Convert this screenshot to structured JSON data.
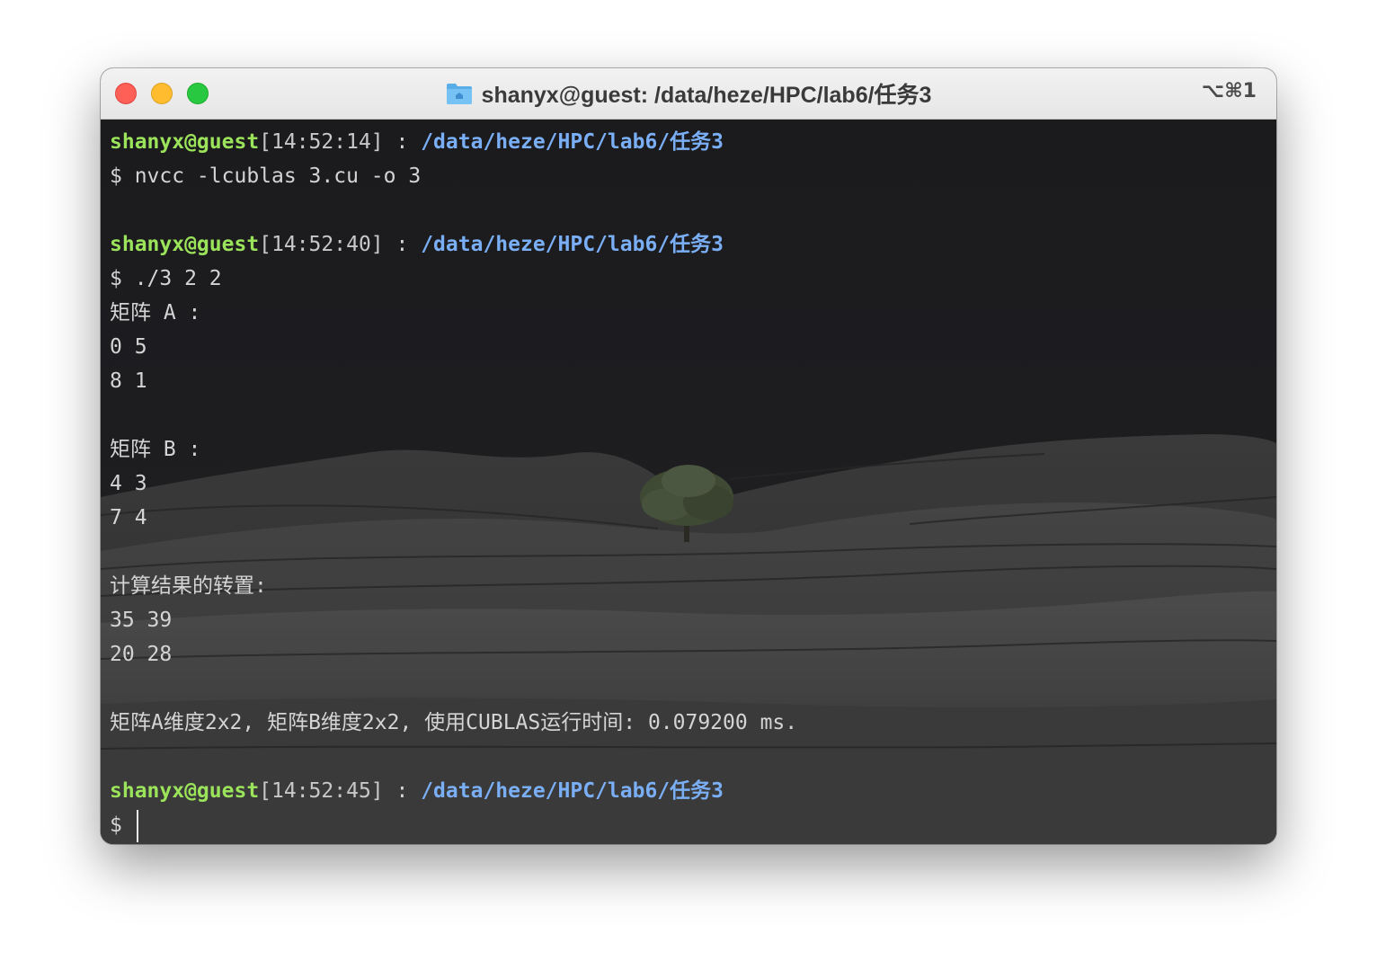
{
  "window": {
    "title": "shanyx@guest: /data/heze/HPC/lab6/任务3",
    "shortcut": "⌥⌘1",
    "icons": {
      "title_icon": "folder-icon"
    },
    "colors": {
      "close": "#fe5f57",
      "minimize": "#febc2e",
      "maximize": "#28c840",
      "prompt_user": "#9be35a",
      "prompt_path": "#7aaef5",
      "text": "#d4d4d4"
    }
  },
  "terminal": {
    "prompts": [
      {
        "user": "shanyx@guest",
        "time": "[14:52:14]",
        "sep": " : ",
        "path": "/data/heze/HPC/lab6/任务3"
      },
      {
        "user": "shanyx@guest",
        "time": "[14:52:40]",
        "sep": " : ",
        "path": "/data/heze/HPC/lab6/任务3"
      },
      {
        "user": "shanyx@guest",
        "time": "[14:52:45]",
        "sep": " : ",
        "path": "/data/heze/HPC/lab6/任务3"
      }
    ],
    "commands": [
      "$ nvcc -lcublas 3.cu -o 3",
      "$ ./3 2 2"
    ],
    "output": [
      "矩阵 A :",
      "0 5",
      "8 1",
      "矩阵 B :",
      "4 3",
      "7 4",
      "计算结果的转置:",
      "35 39",
      "20 28",
      "矩阵A维度2x2, 矩阵B维度2x2, 使用CUBLAS运行时间: 0.079200 ms."
    ],
    "current_input": "$ "
  }
}
